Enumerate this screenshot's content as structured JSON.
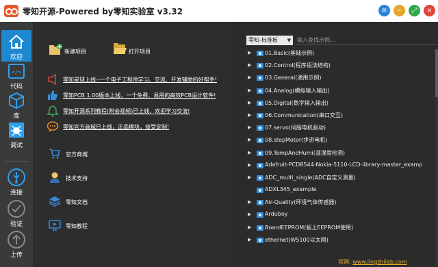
{
  "window": {
    "title": "零知开源-Powered by零知实验室 v3.32",
    "buttons": {
      "menu": "≡",
      "minimize": "−",
      "maximize": "⤢",
      "close": "×"
    }
  },
  "sidebar": {
    "items": [
      {
        "label": "欢迎",
        "icon": "home-icon"
      },
      {
        "label": "代码",
        "icon": "code-icon"
      },
      {
        "label": "库",
        "icon": "cube-icon"
      },
      {
        "label": "调试",
        "icon": "bug-icon"
      },
      {
        "label": "连接",
        "icon": "usb-icon"
      },
      {
        "label": "验证",
        "icon": "check-circle-icon"
      },
      {
        "label": "上传",
        "icon": "upload-circle-icon"
      }
    ]
  },
  "quick_actions": {
    "new_project": "新建项目",
    "open_project": "打开项目"
  },
  "notices": [
    {
      "text": "零知星球上线--一个电子工程师学习、交流、开发辅助的好帮手!",
      "icon": "megaphone-icon"
    },
    {
      "text": "零知PCB 1.00版本上线，一个免费、易用的高效PCB设计软件!",
      "icon": "thumbs-up-icon"
    },
    {
      "text": "零知开源系列教程(附会视频)已上线，欢迎学习交流!",
      "icon": "bell-icon"
    },
    {
      "text": "零知官方商城已上线，正品模块，接受定制!",
      "icon": "chat-icon"
    }
  ],
  "links": [
    {
      "text": "官方商城",
      "icon": "cart-icon"
    },
    {
      "text": "技术支持",
      "icon": "support-icon"
    },
    {
      "text": "零知文档",
      "icon": "layers-icon"
    },
    {
      "text": "零知教程",
      "icon": "video-icon"
    }
  ],
  "board_select": {
    "value": "零知-标准板",
    "arrow": "▼"
  },
  "search": {
    "placeholder": "输入查找示例..."
  },
  "tree": [
    {
      "label": "01.Basic(基础示例)",
      "expandable": true
    },
    {
      "label": "02.Control(程序语法结构)",
      "expandable": true
    },
    {
      "label": "03.General(通用示例)",
      "expandable": true
    },
    {
      "label": "04.Analog(模拟输入输出)",
      "expandable": true
    },
    {
      "label": "05.Digital(数字输入输出)",
      "expandable": true
    },
    {
      "label": "06.Communication(串口交互)",
      "expandable": true
    },
    {
      "label": "07.servo(伺服电机驱动)",
      "expandable": true
    },
    {
      "label": "08.stepMotor(步进电机)",
      "expandable": true
    },
    {
      "label": "09.TempAndHumi(温湿度检测)",
      "expandable": true
    },
    {
      "label": "Adafruit-PCD8544-Nokia-5110-LCD-library-master_examp",
      "expandable": true
    },
    {
      "label": "ADC_multi_single(ADC自定义测量)",
      "expandable": true
    },
    {
      "label": "ADXL345_example",
      "expandable": false
    },
    {
      "label": "Air-Quality(环境气体传感器)",
      "expandable": true
    },
    {
      "label": "Arduboy",
      "expandable": true
    },
    {
      "label": "BoardEEPROM(板上EEPROM使用)",
      "expandable": true
    },
    {
      "label": "ethernet(W5100以太网)",
      "expandable": true
    }
  ],
  "footer": {
    "prefix": "官网:",
    "url": "www.lingzhilab.com"
  },
  "colors": {
    "accent": "#1e88d0",
    "background": "#2b2b2b",
    "sidebar": "#3a3a3a",
    "footer_text": "#e9b329"
  }
}
